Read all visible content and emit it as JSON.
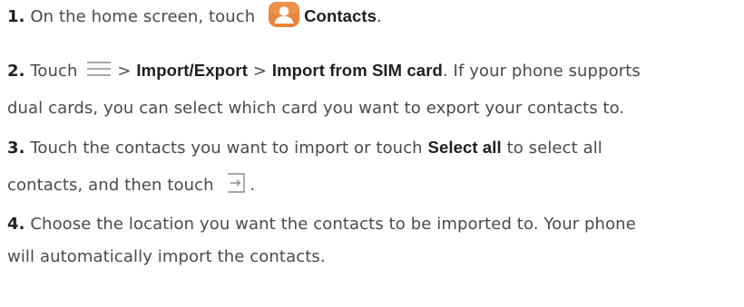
{
  "steps": [
    {
      "number": "1.",
      "pre": "On the home screen, touch",
      "bold": "Contacts",
      "post": "."
    },
    {
      "number": "2.",
      "pre": "Touch",
      "sep1": ">",
      "bold1": "Import/Export",
      "sep2": ">",
      "bold2": "Import from SIM card",
      "post": ". If your phone supports",
      "line2": "dual cards, you can select which card you want to export your contacts to."
    },
    {
      "number": "3.",
      "pre": "Touch the contacts you want to import or touch",
      "bold": "Select all",
      "post": "to select all",
      "line2_pre": "contacts, and then touch",
      "line2_post": "."
    },
    {
      "number": "4.",
      "pre": "Choose the location you want the contacts to be imported to. Your phone",
      "line2": "will automatically import the contacts."
    }
  ],
  "icons": {
    "contacts": "contacts-app-icon",
    "menu": "menu-icon",
    "import": "import-export-icon"
  },
  "colors": {
    "contacts_icon": "#E8843C",
    "text": "#4a4a4a",
    "bold_text": "#1f1f1f",
    "icon_stroke": "#8a8a8a"
  }
}
